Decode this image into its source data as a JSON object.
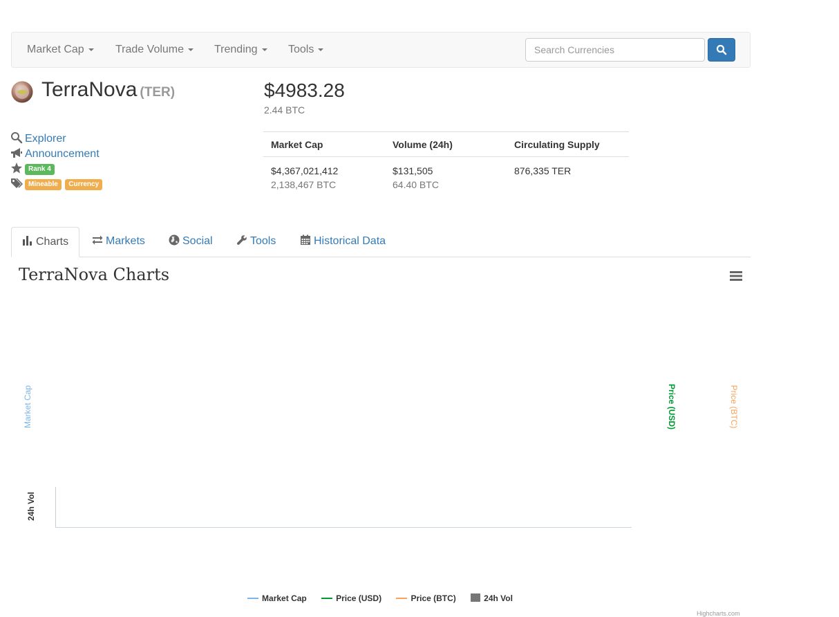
{
  "nav": {
    "items": [
      {
        "label": "Market Cap"
      },
      {
        "label": "Trade Volume"
      },
      {
        "label": "Trending"
      },
      {
        "label": "Tools"
      }
    ],
    "search_placeholder": "Search Currencies"
  },
  "coin": {
    "name": "TerraNova",
    "symbol": "(TER)",
    "price_usd": "$4983.28",
    "price_btc": "2.44 BTC",
    "links": {
      "explorer": "Explorer",
      "announcement": "Announcement"
    },
    "rank_label": "Rank 4",
    "tags": [
      "Mineable",
      "Currency"
    ]
  },
  "stats": {
    "headers": [
      "Market Cap",
      "Volume (24h)",
      "Circulating Supply"
    ],
    "market_cap_usd": "$4,367,021,412",
    "market_cap_btc": "2,138,467 BTC",
    "volume_usd": "$131,505",
    "volume_btc": "64.40 BTC",
    "circulating_supply": "876,335 TER"
  },
  "tabs": [
    {
      "label": "Charts",
      "icon": "bar-chart-icon",
      "active": true
    },
    {
      "label": "Markets",
      "icon": "exchange-icon"
    },
    {
      "label": "Social",
      "icon": "globe-icon"
    },
    {
      "label": "Tools",
      "icon": "wrench-icon"
    },
    {
      "label": "Historical Data",
      "icon": "calendar-icon"
    }
  ],
  "chart": {
    "title": "TerraNova Charts",
    "axis_titles": {
      "market_cap": "Market Cap",
      "price_usd": "Price (USD)",
      "price_btc": "Price (BTC)",
      "vol_24h": "24h Vol"
    },
    "legend": [
      "Market Cap",
      "Price (USD)",
      "Price (BTC)",
      "24h Vol"
    ],
    "credits": "Highcharts.com"
  },
  "colors": {
    "link": "#337ab7",
    "primary_button": "#337ab7",
    "label_success": "#5cb85c",
    "label_warning": "#f0ad4e",
    "series_market_cap": "#7cb5ec",
    "series_price_usd": "#009933",
    "series_price_btc": "#f7a35c",
    "series_vol": "#777777"
  }
}
